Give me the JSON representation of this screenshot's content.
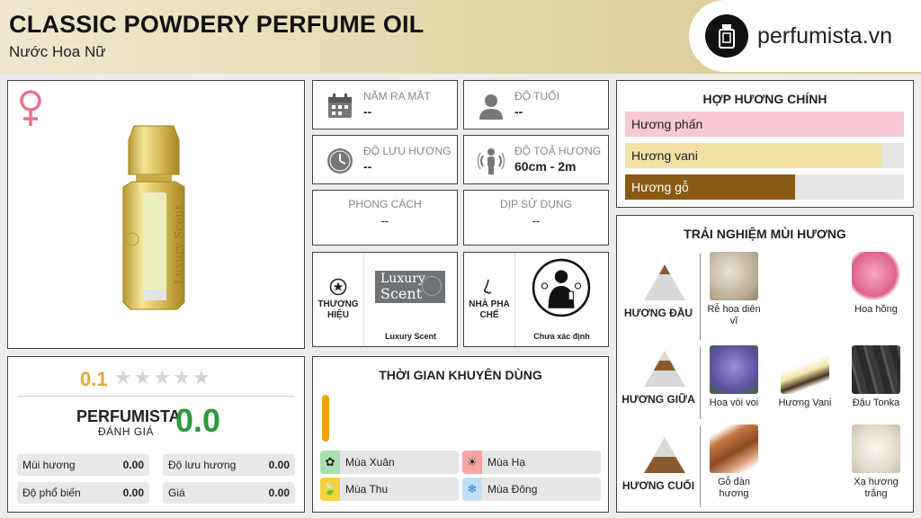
{
  "header": {
    "title": "CLASSIC POWDERY PERFUME OIL",
    "subtitle": "Nước Hoa Nữ",
    "logo_text": "perfumista.vn"
  },
  "product": {
    "gender_icon": "venus-icon",
    "bottle_text": "Luxury Scent"
  },
  "rating": {
    "user_score": "0.1",
    "stars_filled": 0,
    "stars_total": 5,
    "perfumista_label": "PERFUMISTA",
    "perfumista_sub": "ĐÁNH GIÁ",
    "perfumista_score": "0.0",
    "metrics": [
      {
        "label": "Mùi hương",
        "value": "0.00"
      },
      {
        "label": "Độ lưu hương",
        "value": "0.00"
      },
      {
        "label": "Độ phổ biến",
        "value": "0.00"
      },
      {
        "label": "Giá",
        "value": "0.00"
      }
    ]
  },
  "info": {
    "release": {
      "label": "NĂM RA MẮT",
      "value": "--"
    },
    "age": {
      "label": "ĐỘ TUỔI",
      "value": "--"
    },
    "longevity": {
      "label": "ĐỘ LƯU HƯƠNG",
      "value": "--"
    },
    "sillage": {
      "label": "ĐỘ TOẢ HƯƠNG",
      "value": "60cm - 2m"
    },
    "style": {
      "label": "PHONG CÁCH",
      "value": "--"
    },
    "occasion": {
      "label": "DỊP SỬ DỤNG",
      "value": "--"
    }
  },
  "brand": {
    "label": "THƯƠNG HIỆU",
    "logo_text_1": "Luxury",
    "logo_text_2": "Scent",
    "name": "Luxury Scent"
  },
  "perfumer": {
    "label": "NHÀ PHA CHẾ",
    "name": "Chưa xác định"
  },
  "seasons": {
    "title": "THỜI GIAN KHUYÊN DÙNG",
    "items": [
      {
        "label": "Mùa Xuân",
        "color": "#a8e0b0",
        "icon": "spring-icon"
      },
      {
        "label": "Mùa Hạ",
        "color": "#f6a5a5",
        "icon": "sun-icon"
      },
      {
        "label": "Mùa Thu",
        "color": "#f5d43a",
        "icon": "leaf-icon"
      },
      {
        "label": "Mùa Đông",
        "color": "#bfe0f7",
        "icon": "snowflake-icon"
      }
    ]
  },
  "accords": {
    "title": "HỢP HƯƠNG CHÍNH",
    "items": [
      {
        "label": "Hương phấn",
        "level": 1.0,
        "color": "#f8c9d3"
      },
      {
        "label": "Hương vani",
        "level": 0.92,
        "color": "#f2e2a6"
      },
      {
        "label": "Hương gỗ",
        "level": 0.61,
        "color": "#8a5a14"
      }
    ]
  },
  "notes": {
    "title": "TRẢI NGHIỆM MÙI HƯƠNG",
    "top": {
      "label": "HƯƠNG ĐẦU",
      "items": [
        "Rễ hoa diên vĩ",
        "Hoa hồng"
      ]
    },
    "middle": {
      "label": "HƯƠNG GIỮA",
      "items": [
        "Hoa vòi voi",
        "Hương Vani",
        "Đậu Tonka"
      ]
    },
    "base": {
      "label": "HƯƠNG CUỐI",
      "items": [
        "Gỗ đàn hương",
        "Xạ hương trắng"
      ]
    }
  }
}
